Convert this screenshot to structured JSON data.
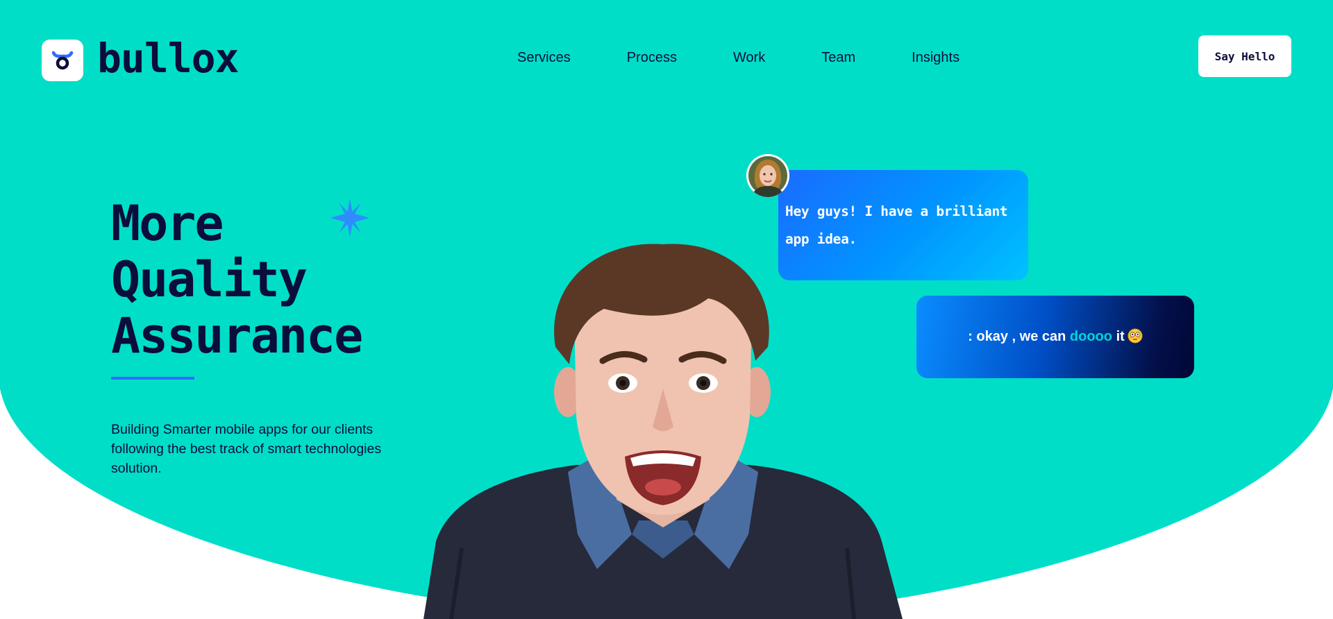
{
  "colors": {
    "teal": "#00dec8",
    "navy": "#0b0d3a",
    "accent_blue": "#2f6bff",
    "white": "#ffffff"
  },
  "header": {
    "brand": "bullox",
    "logo_icon": "bull-ring-icon",
    "nav": [
      "Services",
      "Process",
      "Work",
      "Team",
      "Insights"
    ],
    "cta_label": "Say Hello"
  },
  "hero": {
    "headline": [
      "More",
      "Quality",
      "Assurance"
    ],
    "sparkle_icon": "sparkle-icon",
    "subtitle": "Building Smarter mobile apps for our clients following the best track of smart technologies solution."
  },
  "chat": {
    "message_1": "Hey guys! I have a brilliant app idea.",
    "message_2_prefix": ": okay , we can ",
    "message_2_highlight": "doooo",
    "message_2_suffix": " it",
    "emoji_icon": "flushed-face-emoji-icon",
    "avatar_icon": "woman-avatar-icon"
  }
}
